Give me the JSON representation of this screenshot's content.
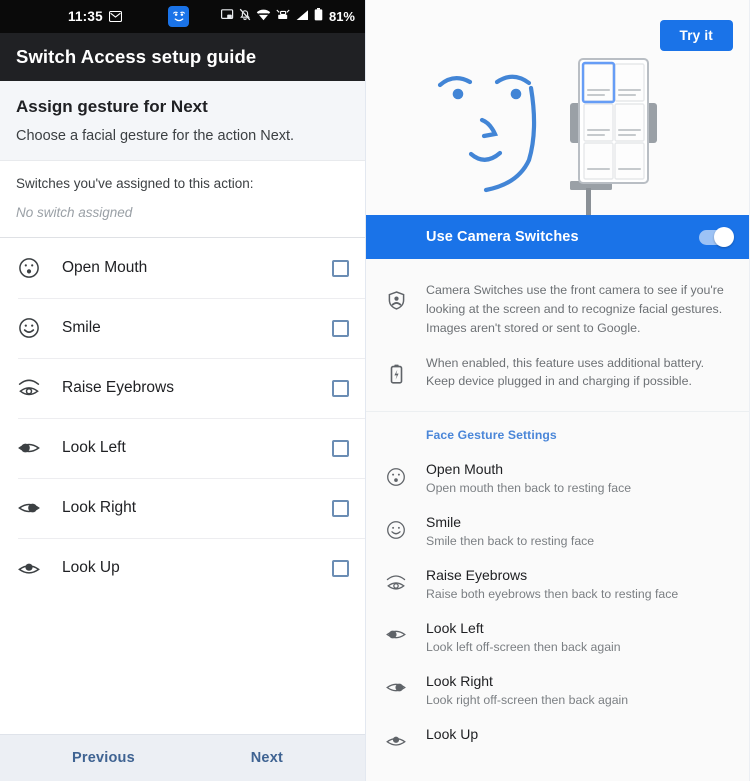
{
  "left": {
    "status_bar": {
      "time": "11:35",
      "battery_percent": "81%",
      "icons": [
        "message-icon",
        "camera-switches-face-icon",
        "screenshot-icon",
        "notifications-off-icon",
        "wifi-icon",
        "vpn-icon",
        "signal-icon",
        "battery-icon"
      ]
    },
    "app_bar": {
      "title": "Switch Access setup guide"
    },
    "headline": {
      "title": "Assign gesture for Next",
      "subtitle": "Choose a facial gesture for the action Next."
    },
    "assigned": {
      "label": "Switches you've assigned to this action:",
      "value": "No switch assigned"
    },
    "gestures": [
      {
        "name": "Open Mouth",
        "icon": "open-mouth-icon",
        "checked": false
      },
      {
        "name": "Smile",
        "icon": "smile-icon",
        "checked": false
      },
      {
        "name": "Raise Eyebrows",
        "icon": "raise-eyebrows-icon",
        "checked": false
      },
      {
        "name": "Look Left",
        "icon": "look-left-icon",
        "checked": false
      },
      {
        "name": "Look Right",
        "icon": "look-right-icon",
        "checked": false
      },
      {
        "name": "Look Up",
        "icon": "look-up-icon",
        "checked": false
      }
    ],
    "nav": {
      "previous": "Previous",
      "next": "Next"
    }
  },
  "right": {
    "try_it_label": "Try it",
    "camera_bar": {
      "label": "Use Camera Switches",
      "toggle_on": true
    },
    "info": [
      {
        "icon": "privacy-shield-icon",
        "text": "Camera Switches use the front camera to see if you're looking at the screen and to recognize facial gestures. Images aren't stored or sent to Google."
      },
      {
        "icon": "battery-charging-icon",
        "text": "When enabled, this feature uses additional battery. Keep device plugged in and charging if possible."
      }
    ],
    "face_gesture_settings": {
      "header": "Face Gesture Settings",
      "items": [
        {
          "title": "Open Mouth",
          "desc": "Open mouth then back to resting face",
          "icon": "open-mouth-icon"
        },
        {
          "title": "Smile",
          "desc": "Smile then back to resting face",
          "icon": "smile-icon"
        },
        {
          "title": "Raise Eyebrows",
          "desc": "Raise both eyebrows then back to resting face",
          "icon": "raise-eyebrows-icon"
        },
        {
          "title": "Look Left",
          "desc": "Look left off-screen then back again",
          "icon": "look-left-icon"
        },
        {
          "title": "Look Right",
          "desc": "Look right off-screen then back again",
          "icon": "look-right-icon"
        },
        {
          "title": "Look Up",
          "desc": "",
          "icon": "look-up-icon"
        }
      ]
    }
  },
  "colors": {
    "accent_blue": "#1a73e8",
    "app_bar_dark": "#202124",
    "status_bar_black": "#0a0a0a",
    "link_blue": "#4a86d8",
    "nav_blue": "#3f6392"
  }
}
